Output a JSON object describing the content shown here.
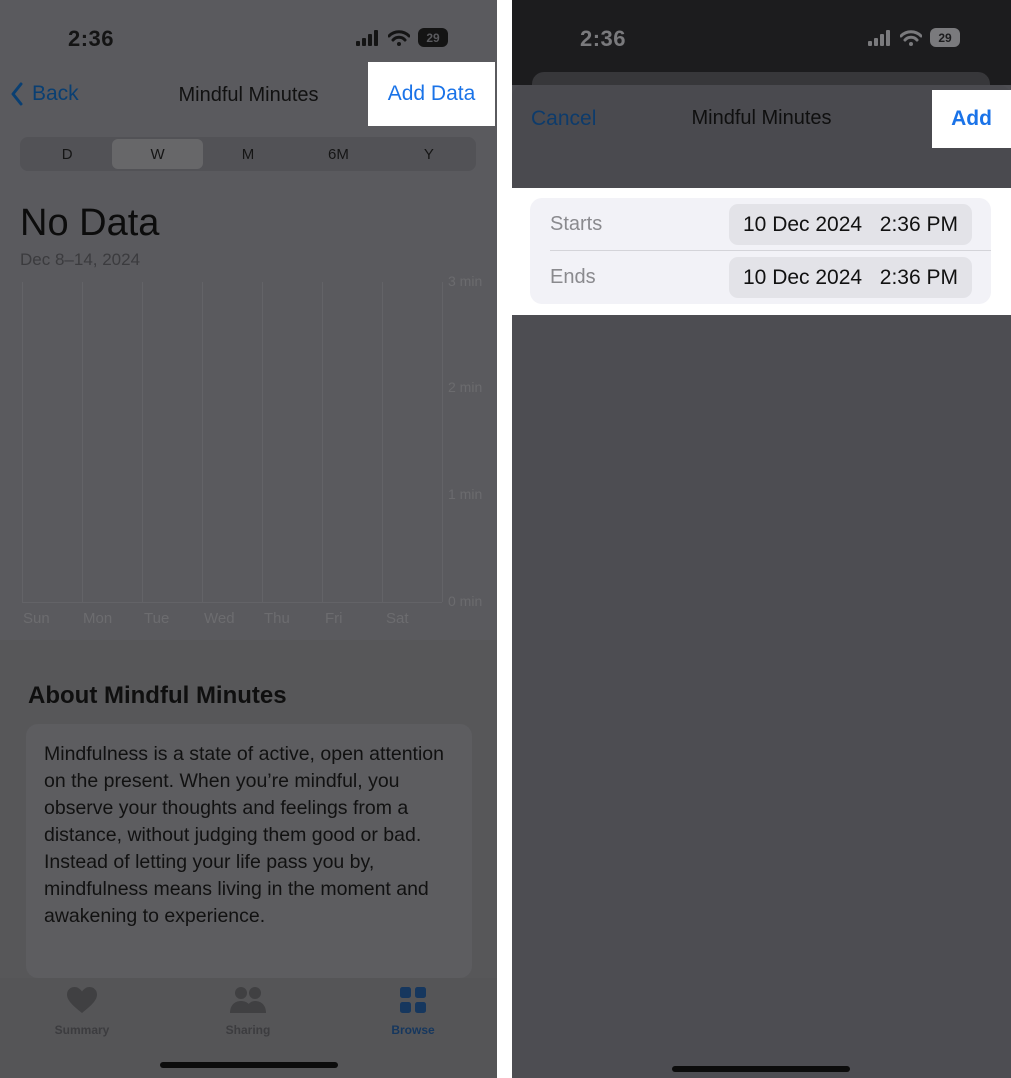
{
  "left": {
    "status": {
      "time": "2:36",
      "battery": "29"
    },
    "nav": {
      "back": "Back",
      "title": "Mindful Minutes",
      "add_data": "Add Data"
    },
    "segments": [
      "D",
      "W",
      "M",
      "6M",
      "Y"
    ],
    "selected_segment": "W",
    "summary": {
      "no_data": "No Data",
      "date_range": "Dec 8–14, 2024"
    },
    "chart_data": {
      "type": "bar",
      "categories": [
        "Sun",
        "Mon",
        "Tue",
        "Wed",
        "Thu",
        "Fri",
        "Sat"
      ],
      "values": [
        0,
        0,
        0,
        0,
        0,
        0,
        0
      ],
      "y_ticks": [
        "3 min",
        "2 min",
        "1 min",
        "0 min"
      ],
      "ylim": [
        0,
        3
      ]
    },
    "about": {
      "title": "About Mindful Minutes",
      "body": "Mindfulness is a state of active, open attention on the present. When you’re mindful, you observe your thoughts and feelings from a distance, without judging them good or bad. Instead of letting your life pass you by, mindfulness means living in the moment and awakening to experience."
    },
    "tabbar": [
      {
        "label": "Summary",
        "icon": "heart-icon"
      },
      {
        "label": "Sharing",
        "icon": "people-icon"
      },
      {
        "label": "Browse",
        "icon": "grid-icon"
      }
    ],
    "active_tab": "Browse"
  },
  "right": {
    "status": {
      "time": "2:36",
      "battery": "29"
    },
    "nav": {
      "cancel": "Cancel",
      "title": "Mindful Minutes",
      "add": "Add"
    },
    "form": {
      "starts": {
        "label": "Starts",
        "date": "10 Dec 2024",
        "time": "2:36 PM"
      },
      "ends": {
        "label": "Ends",
        "date": "10 Dec 2024",
        "time": "2:36 PM"
      }
    }
  },
  "colors": {
    "accent_blue": "#1a73e8",
    "dimmed_overlay": "#5a5a5e",
    "highlight": "#ffffff"
  }
}
